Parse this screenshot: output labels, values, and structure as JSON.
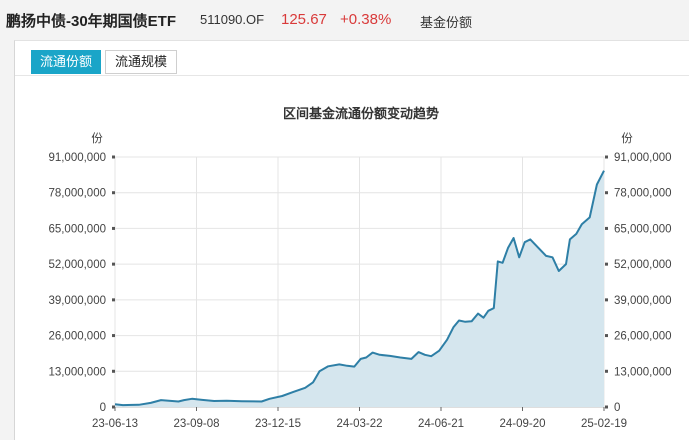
{
  "header": {
    "name": "鹏扬中债-30年期国债ETF",
    "code": "511090.OF",
    "price": "125.67",
    "change": "+0.38%",
    "tag": "基金份额"
  },
  "tabs": [
    {
      "label": "流通份额",
      "active": true
    },
    {
      "label": "流通规模",
      "active": false
    }
  ],
  "colors": {
    "accent": "#1aa5c8",
    "line": "#2e7fa6",
    "fill": "#d5e6ee",
    "up": "#d93a3a"
  },
  "chart_data": {
    "type": "area",
    "title": "区间基金流通份额变动趋势",
    "y_unit_left": "份",
    "y_unit_right": "份",
    "ylim": [
      0,
      91000000
    ],
    "y_ticks": [
      0,
      13000000,
      26000000,
      39000000,
      52000000,
      65000000,
      78000000,
      91000000
    ],
    "y_tick_labels": [
      "0",
      "13,000,000",
      "26,000,000",
      "39,000,000",
      "52,000,000",
      "65,000,000",
      "78,000,000",
      "91,000,000"
    ],
    "x_tick_labels": [
      "23-06-13",
      "23-09-08",
      "23-12-15",
      "24-03-22",
      "24-06-21",
      "24-09-20",
      "25-02-19"
    ],
    "grid": true,
    "x_start": "2023-06-13",
    "x_end": "2025-02-19",
    "series": [
      {
        "points": [
          [
            "2023-06-13",
            1000000
          ],
          [
            "2023-06-23",
            700000
          ],
          [
            "2023-07-13",
            800000
          ],
          [
            "2023-07-28",
            1500000
          ],
          [
            "2023-08-10",
            2500000
          ],
          [
            "2023-08-24",
            2200000
          ],
          [
            "2023-09-01",
            2000000
          ],
          [
            "2023-09-08",
            2500000
          ],
          [
            "2023-09-18",
            3000000
          ],
          [
            "2023-10-01",
            2600000
          ],
          [
            "2023-10-16",
            2200000
          ],
          [
            "2023-11-01",
            2300000
          ],
          [
            "2023-11-20",
            2100000
          ],
          [
            "2023-12-15",
            2000000
          ],
          [
            "2023-12-25",
            3000000
          ],
          [
            "2024-01-10",
            4000000
          ],
          [
            "2024-01-24",
            5500000
          ],
          [
            "2024-02-08",
            7000000
          ],
          [
            "2024-02-18",
            9000000
          ],
          [
            "2024-02-26",
            13000000
          ],
          [
            "2024-03-08",
            14800000
          ],
          [
            "2024-03-22",
            15500000
          ],
          [
            "2024-04-01",
            15000000
          ],
          [
            "2024-04-10",
            14700000
          ],
          [
            "2024-04-18",
            17500000
          ],
          [
            "2024-04-25",
            18000000
          ],
          [
            "2024-05-03",
            19800000
          ],
          [
            "2024-05-12",
            19000000
          ],
          [
            "2024-05-25",
            18600000
          ],
          [
            "2024-06-07",
            18000000
          ],
          [
            "2024-06-21",
            17500000
          ],
          [
            "2024-06-30",
            20000000
          ],
          [
            "2024-07-08",
            19000000
          ],
          [
            "2024-07-16",
            18500000
          ],
          [
            "2024-07-26",
            20500000
          ],
          [
            "2024-08-05",
            24500000
          ],
          [
            "2024-08-13",
            29000000
          ],
          [
            "2024-08-20",
            31500000
          ],
          [
            "2024-08-28",
            31000000
          ],
          [
            "2024-09-05",
            31200000
          ],
          [
            "2024-09-13",
            34000000
          ],
          [
            "2024-09-20",
            32500000
          ],
          [
            "2024-09-26",
            35000000
          ],
          [
            "2024-10-03",
            36000000
          ],
          [
            "2024-10-08",
            53000000
          ],
          [
            "2024-10-14",
            52500000
          ],
          [
            "2024-10-21",
            58000000
          ],
          [
            "2024-10-28",
            61500000
          ],
          [
            "2024-11-04",
            54500000
          ],
          [
            "2024-11-11",
            60000000
          ],
          [
            "2024-11-18",
            61000000
          ],
          [
            "2024-11-28",
            58000000
          ],
          [
            "2024-12-08",
            55000000
          ],
          [
            "2024-12-16",
            54500000
          ],
          [
            "2024-12-24",
            49500000
          ],
          [
            "2025-01-02",
            52000000
          ],
          [
            "2025-01-07",
            61000000
          ],
          [
            "2025-01-15",
            63000000
          ],
          [
            "2025-01-22",
            66500000
          ],
          [
            "2025-02-01",
            69000000
          ],
          [
            "2025-02-10",
            81000000
          ],
          [
            "2025-02-19",
            86000000
          ]
        ]
      }
    ]
  }
}
